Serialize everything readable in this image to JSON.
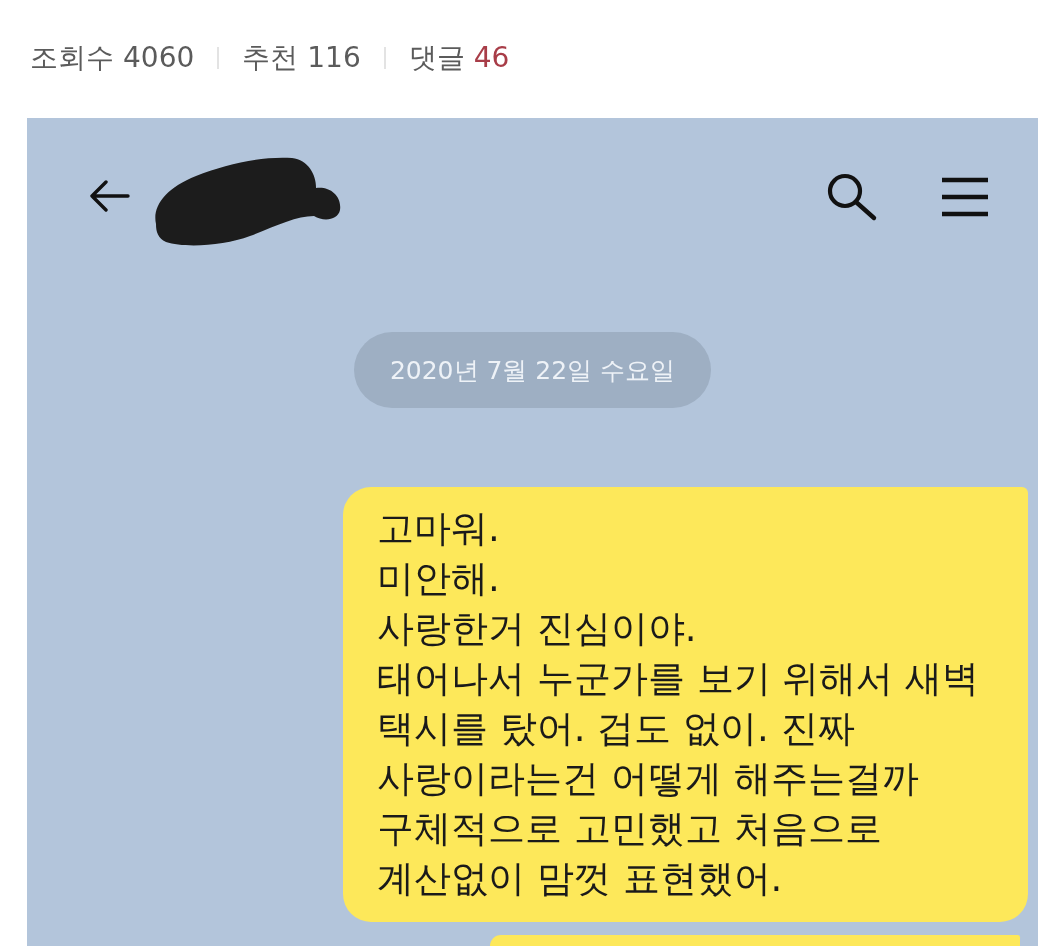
{
  "stats": [
    {
      "label": "조회수",
      "value": "4060",
      "color": "#5b5b5b"
    },
    {
      "label": "추천",
      "value": "116",
      "color": "#5b5b5b"
    },
    {
      "label": "댓글",
      "value": "46",
      "color": "#a83d48"
    }
  ],
  "chat": {
    "date": "2020년 7월 22일 수요일",
    "messages": [
      {
        "text": "고마워.\n미안해.\n사랑한거 진심이야.\n태어나서 누군가를 보기 위해서 새벽\n택시를 탔어. 겁도 없이. 진짜\n사랑이라는건 어떻게 해주는걸까\n구체적으로 고민했고 처음으로\n계산없이 맘껏 표현했어."
      }
    ]
  }
}
